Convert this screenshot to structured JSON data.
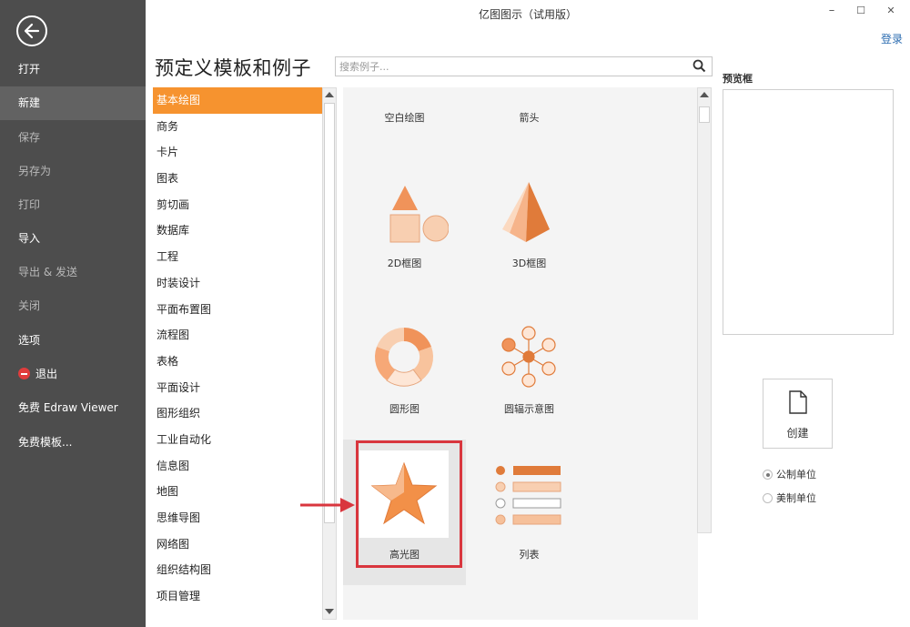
{
  "window": {
    "title": "亿图图示（试用版）",
    "minimize": "–",
    "maximize": "☐",
    "close": "✕",
    "login": "登录"
  },
  "sidebar": {
    "items": [
      {
        "label": "打开"
      },
      {
        "label": "新建"
      },
      {
        "label": "保存"
      },
      {
        "label": "另存为"
      },
      {
        "label": "打印"
      },
      {
        "label": "导入"
      },
      {
        "label": "导出 & 发送"
      },
      {
        "label": "关闭"
      },
      {
        "label": "选项"
      },
      {
        "label": "退出"
      },
      {
        "label": "免费 Edraw Viewer"
      },
      {
        "label": "免费模板..."
      }
    ]
  },
  "header": {
    "heading": "预定义模板和例子",
    "search_placeholder": "搜索例子...",
    "preview_label": "预览框"
  },
  "categories": [
    "基本绘图",
    "商务",
    "卡片",
    "图表",
    "剪切画",
    "数据库",
    "工程",
    "时装设计",
    "平面布置图",
    "流程图",
    "表格",
    "平面设计",
    "图形组织",
    "工业自动化",
    "信息图",
    "地图",
    "思维导图",
    "网络图",
    "组织结构图",
    "项目管理"
  ],
  "templates": [
    {
      "label": "空白绘图",
      "icon": "blank-icon"
    },
    {
      "label": "箭头",
      "icon": "arrow-icon"
    },
    {
      "label": "2D框图",
      "icon": "2d-shapes-icon"
    },
    {
      "label": "3D框图",
      "icon": "3d-pyramid-icon"
    },
    {
      "label": "圆形图",
      "icon": "circular-chart-icon"
    },
    {
      "label": "圆辐示意图",
      "icon": "radial-diagram-icon"
    },
    {
      "label": "高光图",
      "icon": "highlight-star-icon"
    },
    {
      "label": "列表",
      "icon": "list-icon"
    }
  ],
  "create": {
    "label": "创建",
    "units": [
      {
        "label": "公制单位",
        "selected": true
      },
      {
        "label": "美制单位",
        "selected": false
      }
    ]
  },
  "colors": {
    "accent": "#f6932f",
    "sidebar_bg": "#4d4d4d",
    "highlight_border": "#d9363e"
  }
}
